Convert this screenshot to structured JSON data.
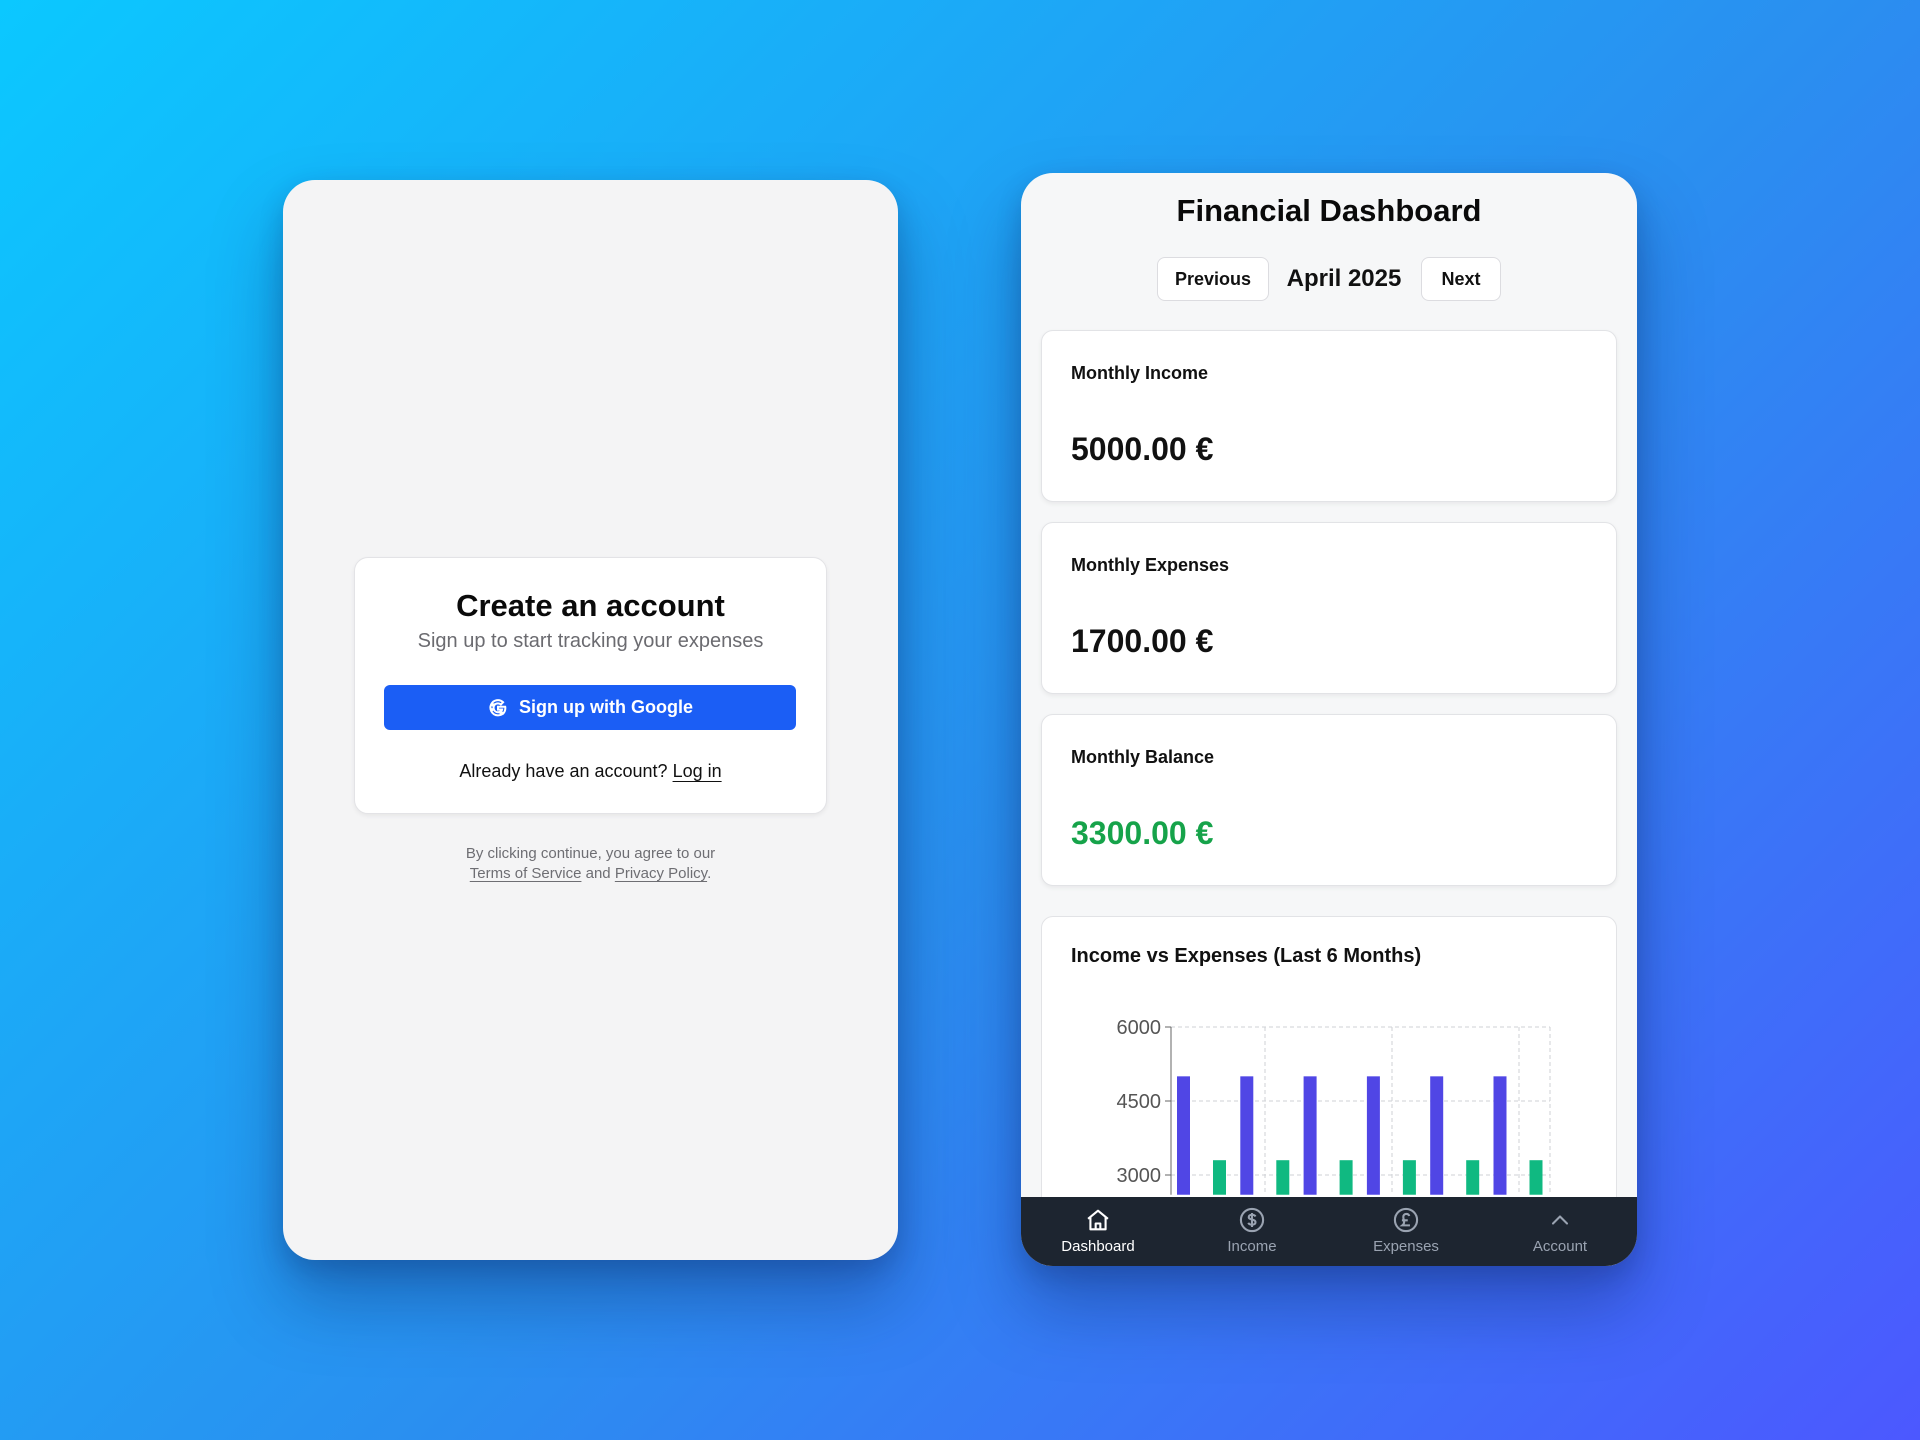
{
  "signup": {
    "title": "Create an account",
    "subtitle": "Sign up to start tracking your expenses",
    "google_button": "Sign up with Google",
    "login_prompt": "Already have an account?",
    "login_link": "Log in",
    "legal_line1": "By clicking continue, you agree to our",
    "terms_link": "Terms of Service",
    "and_text": "and",
    "privacy_link": "Privacy Policy",
    "period": "."
  },
  "dashboard": {
    "title": "Financial Dashboard",
    "prev_label": "Previous",
    "month": "April 2025",
    "next_label": "Next",
    "cards": [
      {
        "label": "Monthly Income",
        "value": "5000.00 €"
      },
      {
        "label": "Monthly Expenses",
        "value": "1700.00 €"
      },
      {
        "label": "Monthly Balance",
        "value": "3300.00 €"
      }
    ],
    "chart_title": "Income vs Expenses (Last 6 Months)",
    "balance_color": "#16a34a"
  },
  "chart_data": {
    "type": "bar",
    "title": "Income vs Expenses (Last 6 Months)",
    "y_ticks": [
      3000,
      4500,
      6000
    ],
    "ylim_visible": [
      2600,
      6000
    ],
    "grid": true,
    "series": [
      {
        "values": [
          5000,
          5000,
          5000,
          5000,
          5000,
          5000
        ],
        "color": "#5046e5"
      },
      {
        "values": [
          3300,
          3300,
          3300,
          3300,
          3300,
          3300
        ],
        "color": "#10b981"
      }
    ]
  },
  "bottom_nav": {
    "tabs": [
      {
        "label": "Dashboard",
        "icon": "home-icon",
        "active": true
      },
      {
        "label": "Income",
        "icon": "dollar-circle-icon",
        "active": false
      },
      {
        "label": "Expenses",
        "icon": "pound-circle-icon",
        "active": false
      },
      {
        "label": "Account",
        "icon": "chevron-up-icon",
        "active": false
      }
    ]
  }
}
